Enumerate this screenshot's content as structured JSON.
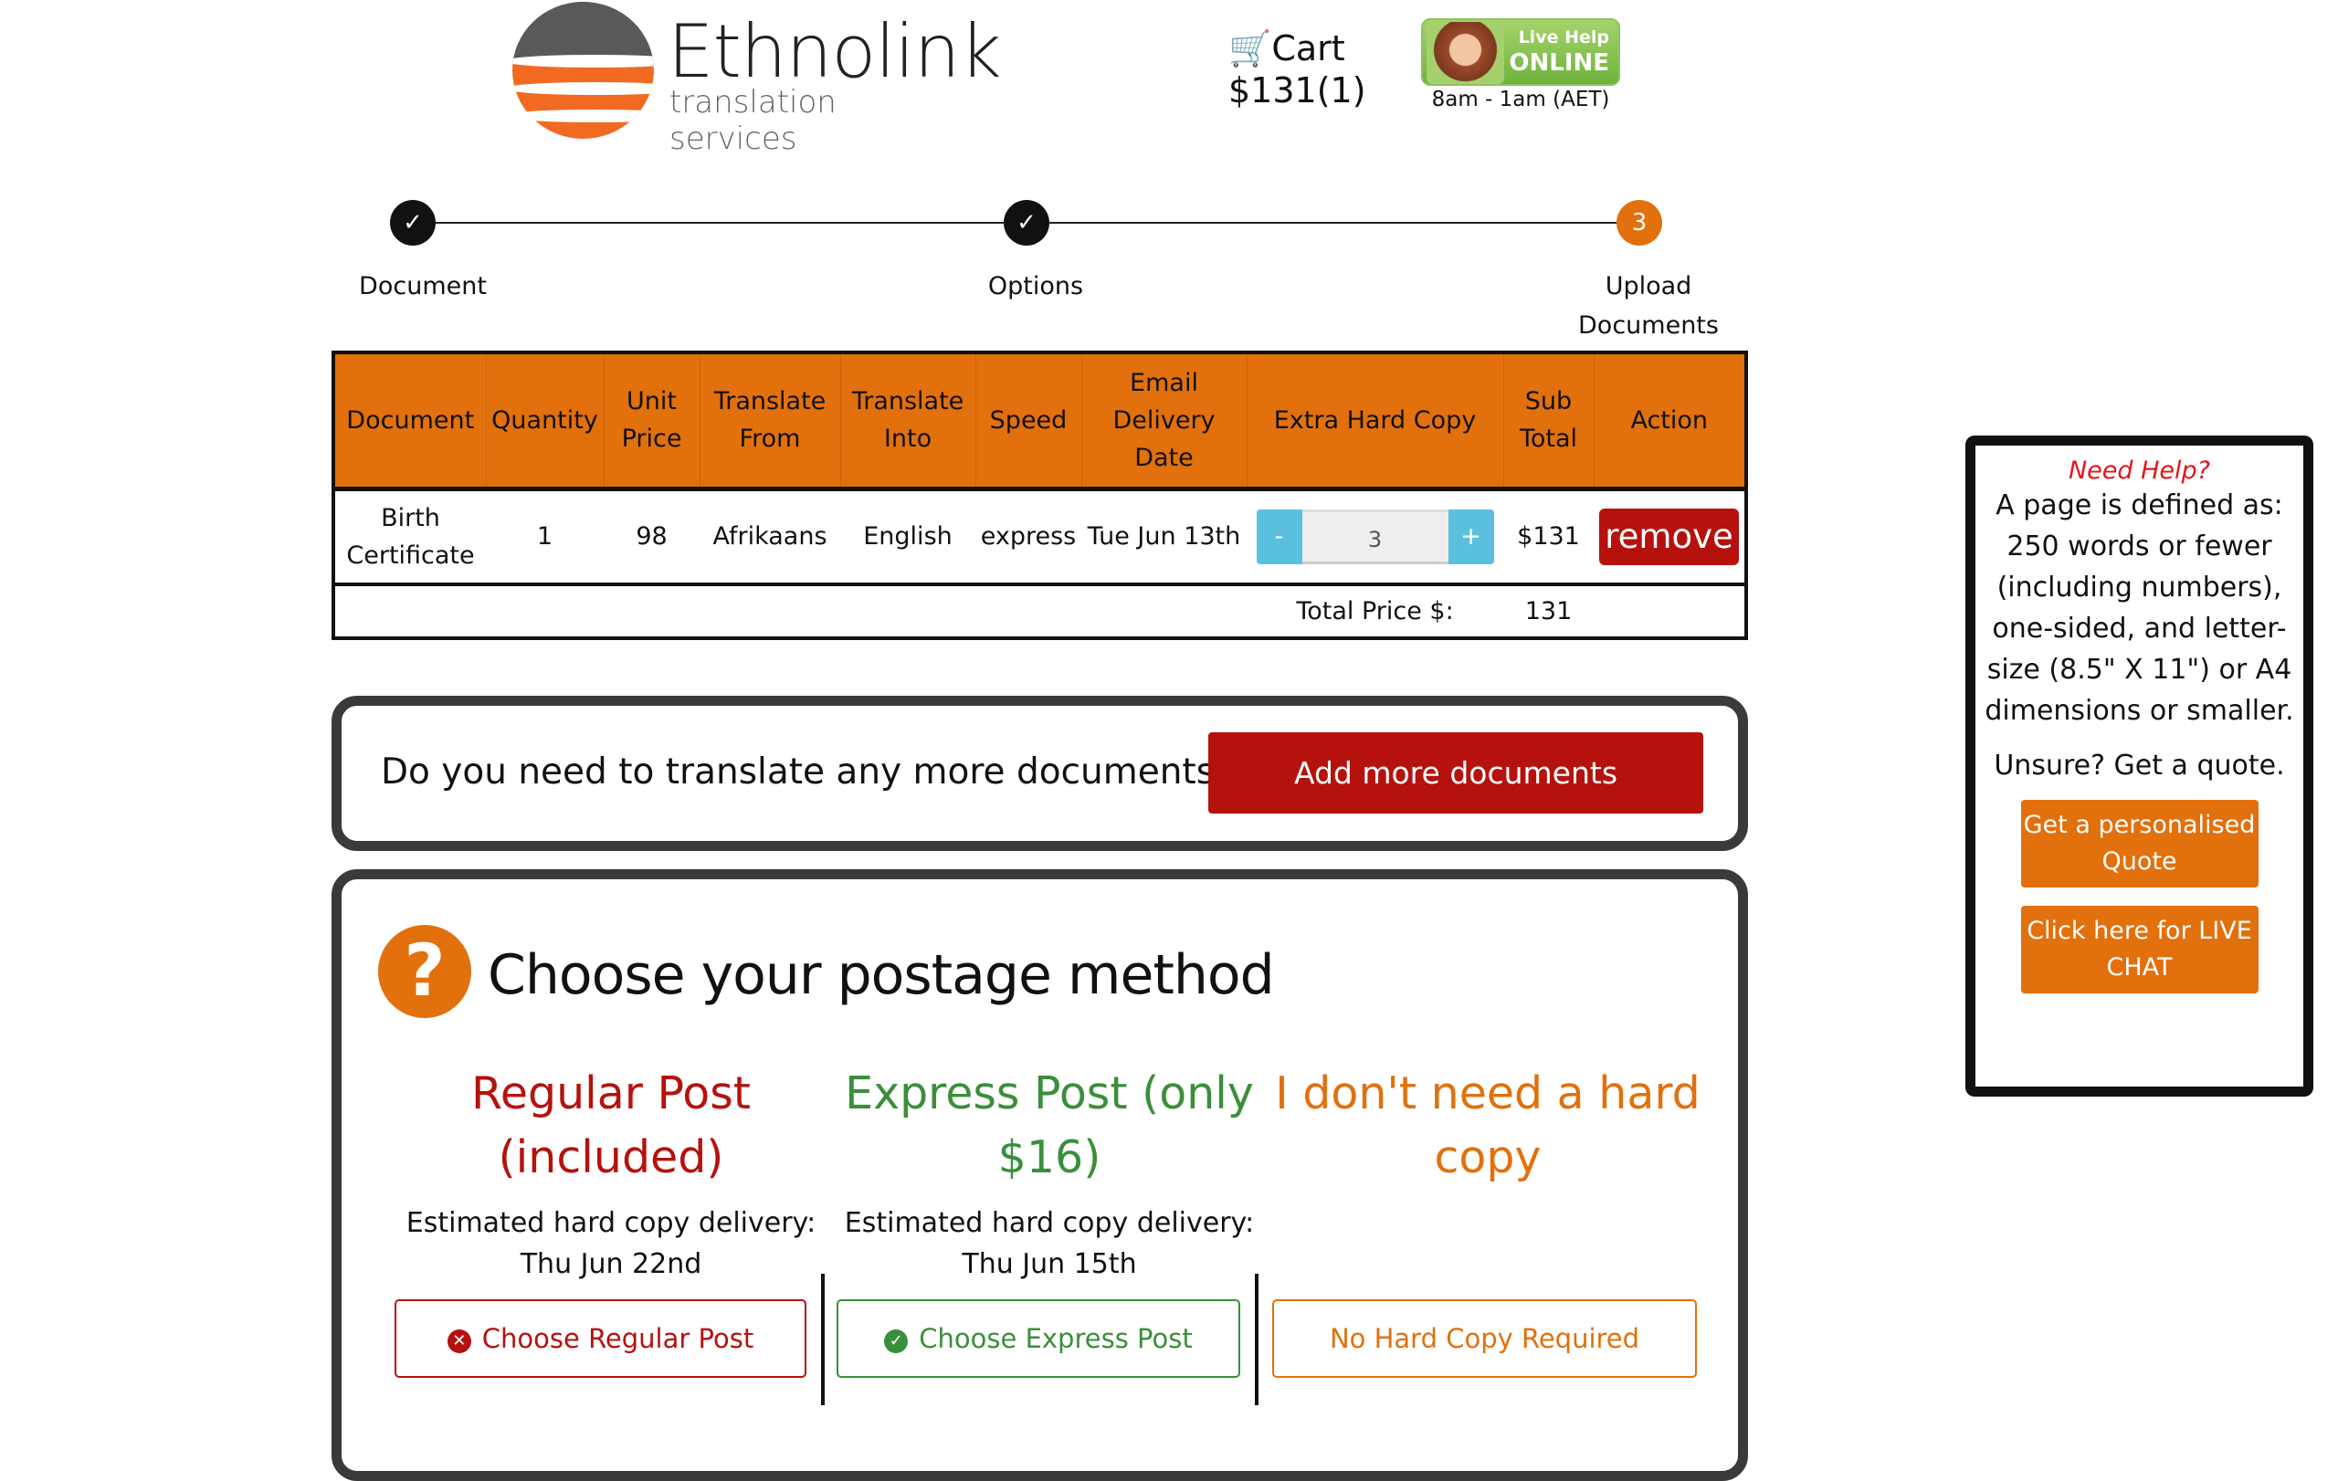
{
  "header": {
    "logo_name": "Ethnolink",
    "logo_sub": "translation services",
    "cart_label": "Cart",
    "cart_total": "$131(1)",
    "live_help_line1": "Live Help",
    "live_help_line2": "ONLINE",
    "hours": "8am - 1am (AET)"
  },
  "steps": [
    {
      "num": "✓",
      "label": "Document"
    },
    {
      "num": "✓",
      "label": "Options"
    },
    {
      "num": "3",
      "label": "Upload Documents"
    }
  ],
  "table": {
    "headers": [
      "Document",
      "Quantity",
      "Unit Price",
      "Translate From",
      "Translate Into",
      "Speed",
      "Email Delivery Date",
      "Extra Hard Copy",
      "Sub Total",
      "Action"
    ],
    "row": {
      "document": "Birth Certificate",
      "quantity": "1",
      "unit_price": "98",
      "from": "Afrikaans",
      "into": "English",
      "speed": "express",
      "delivery": "Tue Jun 13th",
      "minus": "-",
      "copies": "3",
      "plus": "+",
      "subtotal": "$131",
      "action": "remove"
    },
    "total_label": "Total Price $:",
    "total_value": "131"
  },
  "more": {
    "question": "Do you need to translate any more documents?",
    "button": "Add more documents"
  },
  "postage": {
    "title": "Choose your postage method",
    "icon": "?",
    "options": [
      {
        "heading": "Regular Post (included)",
        "est_label": "Estimated hard copy delivery:",
        "date": "Thu Jun 22nd",
        "button": "Choose Regular Post",
        "color": "#b5120e"
      },
      {
        "heading": "Express Post (only $16)",
        "est_label": "Estimated hard copy delivery:",
        "date": "Thu Jun 15th",
        "button": "Choose Express Post",
        "color": "#3a8f3a"
      },
      {
        "heading": "I don't need a hard copy",
        "button": "No Hard Copy Required",
        "color": "#e2700c"
      }
    ]
  },
  "help": {
    "title": "Need Help?",
    "text": "A page is defined as: 250 words or fewer (including numbers), one-sided, and letter-size (8.5\" X 11\") or A4 dimensions or smaller.",
    "unsure": "Unsure? Get a quote.",
    "quote_button": "Get a personalised Quote",
    "chat_button": "Click here for LIVE CHAT"
  }
}
